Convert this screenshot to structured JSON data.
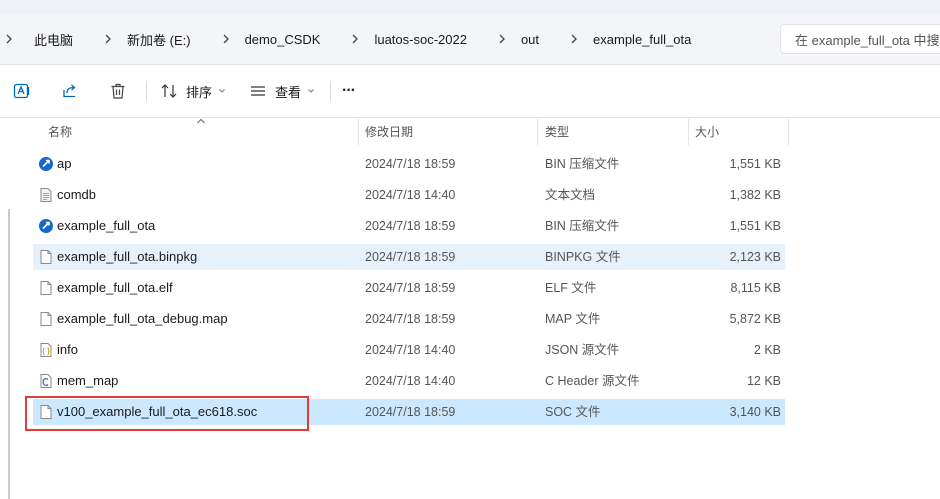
{
  "breadcrumbs": [
    "此电脑",
    "新加卷 (E:)",
    "demo_CSDK",
    "luatos-soc-2022",
    "out",
    "example_full_ota"
  ],
  "search": {
    "placeholder": "在 example_full_ota 中搜"
  },
  "toolbar": {
    "sort_label": "排序",
    "view_label": "查看",
    "more_label": "···"
  },
  "columns": {
    "name": "名称",
    "modified": "修改日期",
    "type": "类型",
    "size": "大小"
  },
  "files": [
    {
      "name": "ap",
      "modified": "2024/7/18 18:59",
      "type": "BIN 压缩文件",
      "size": "1,551 KB",
      "icon": "bin-archive-icon"
    },
    {
      "name": "comdb",
      "modified": "2024/7/18 14:40",
      "type": "文本文档",
      "size": "1,382 KB",
      "icon": "text-document-icon"
    },
    {
      "name": "example_full_ota",
      "modified": "2024/7/18 18:59",
      "type": "BIN 压缩文件",
      "size": "1,551 KB",
      "icon": "bin-archive-icon"
    },
    {
      "name": "example_full_ota.binpkg",
      "modified": "2024/7/18 18:59",
      "type": "BINPKG 文件",
      "size": "2,123 KB",
      "icon": "blank-file-icon"
    },
    {
      "name": "example_full_ota.elf",
      "modified": "2024/7/18 18:59",
      "type": "ELF 文件",
      "size": "8,115 KB",
      "icon": "blank-file-icon"
    },
    {
      "name": "example_full_ota_debug.map",
      "modified": "2024/7/18 18:59",
      "type": "MAP 文件",
      "size": "5,872 KB",
      "icon": "blank-file-icon"
    },
    {
      "name": "info",
      "modified": "2024/7/18 14:40",
      "type": "JSON 源文件",
      "size": "2 KB",
      "icon": "json-file-icon"
    },
    {
      "name": "mem_map",
      "modified": "2024/7/18 14:40",
      "type": "C Header 源文件",
      "size": "12 KB",
      "icon": "c-header-file-icon"
    },
    {
      "name": "v100_example_full_ota_ec618.soc",
      "modified": "2024/7/18 18:59",
      "type": "SOC 文件",
      "size": "3,140 KB",
      "icon": "blank-file-icon"
    }
  ],
  "colors": {
    "hover": "#e5f1fb",
    "selected": "#cce8ff",
    "highlight_box": "#e03a3a",
    "accent": "#0067c0"
  }
}
